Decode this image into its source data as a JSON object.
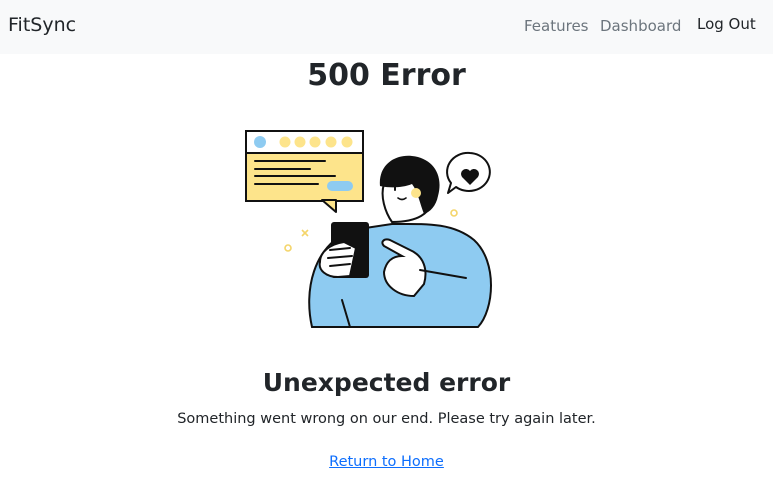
{
  "navbar": {
    "brand": "FitSync",
    "links": [
      "Features",
      "Dashboard"
    ],
    "logout_label": "Log Out"
  },
  "main": {
    "title": "500 Error",
    "heading": "Unexpected error",
    "message": "Something went wrong on our end. Please try again later.",
    "home_link": "Return to Home"
  },
  "colors": {
    "navbar_bg": "#f8f9fa",
    "link": "#0d6efd",
    "illustration_blue": "#8ecbf1",
    "illustration_yellow": "#fde48b"
  }
}
